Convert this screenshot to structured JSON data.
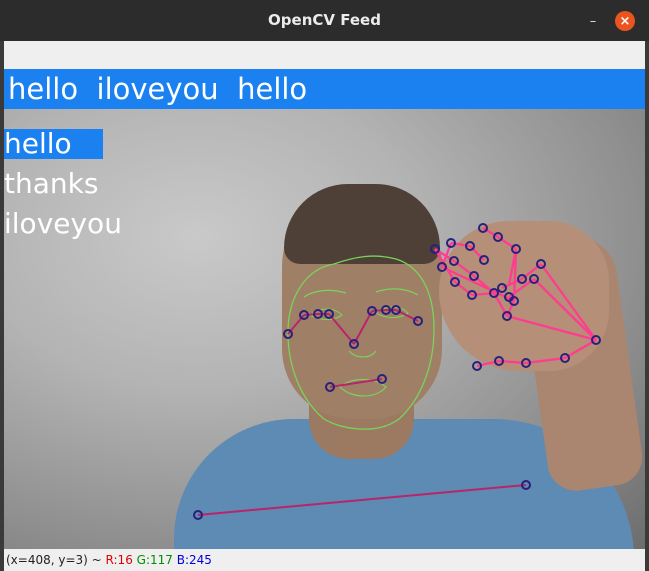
{
  "window": {
    "title": "OpenCV Feed",
    "minimize_glyph": "–",
    "close_glyph": "×"
  },
  "feed": {
    "sentence": "hello  iloveyou  hello",
    "actions": [
      {
        "label": "hello",
        "probability": 0.85
      },
      {
        "label": "thanks",
        "probability": 0.0
      },
      {
        "label": "iloveyou",
        "probability": 0.0
      }
    ],
    "colors": {
      "banner": "#1b80f0",
      "face_mesh": "#7ad35a",
      "pose_line": "#b9246a",
      "hand_line": "#ff3c8f",
      "landmark": "#2a1f7a"
    }
  },
  "status": {
    "position": "(x=408, y=3) ~",
    "r": "R:16",
    "g": "G:117",
    "b": "B:245"
  }
}
